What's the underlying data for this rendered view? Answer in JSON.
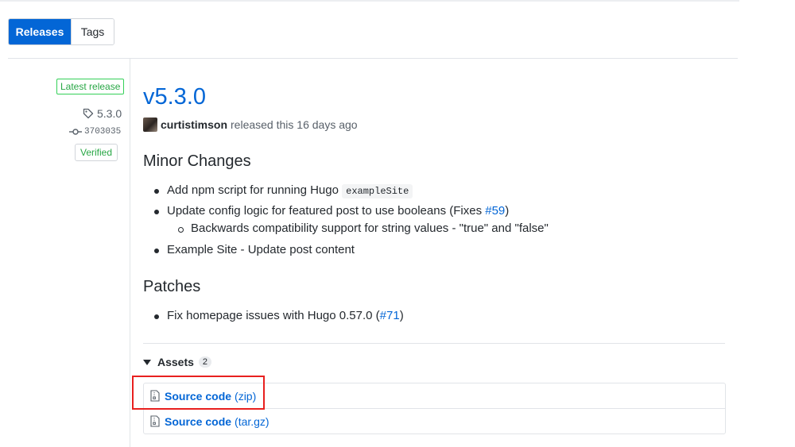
{
  "tabs": {
    "releases": "Releases",
    "tags": "Tags"
  },
  "sidebar": {
    "latest_label": "Latest release",
    "tag": "5.3.0",
    "commit": "3703035",
    "verified": "Verified"
  },
  "release": {
    "title": "v5.3.0",
    "author": "curtistimson",
    "released_text": "released this 16 days ago"
  },
  "sections": {
    "minor": {
      "heading": "Minor Changes",
      "item1_text": "Add npm script for running Hugo",
      "item1_code": "exampleSite",
      "item2_text": "Update config logic for featured post to use booleans (Fixes ",
      "item2_link": "#59",
      "item2_close": ")",
      "item2_sub": "Backwards compatibility support for string values - \"true\" and \"false\"",
      "item3_text": "Example Site - Update post content"
    },
    "patches": {
      "heading": "Patches",
      "item1_text": "Fix homepage issues with Hugo 0.57.0 (",
      "item1_link": "#71",
      "item1_close": ")"
    }
  },
  "assets": {
    "label": "Assets",
    "count": "2",
    "items": [
      {
        "name": "Source code",
        "ext": "(zip)"
      },
      {
        "name": "Source code",
        "ext": "(tar.gz)"
      }
    ]
  },
  "colors": {
    "accent": "#0366d6",
    "success": "#28a745",
    "highlight": "#e8201f"
  }
}
